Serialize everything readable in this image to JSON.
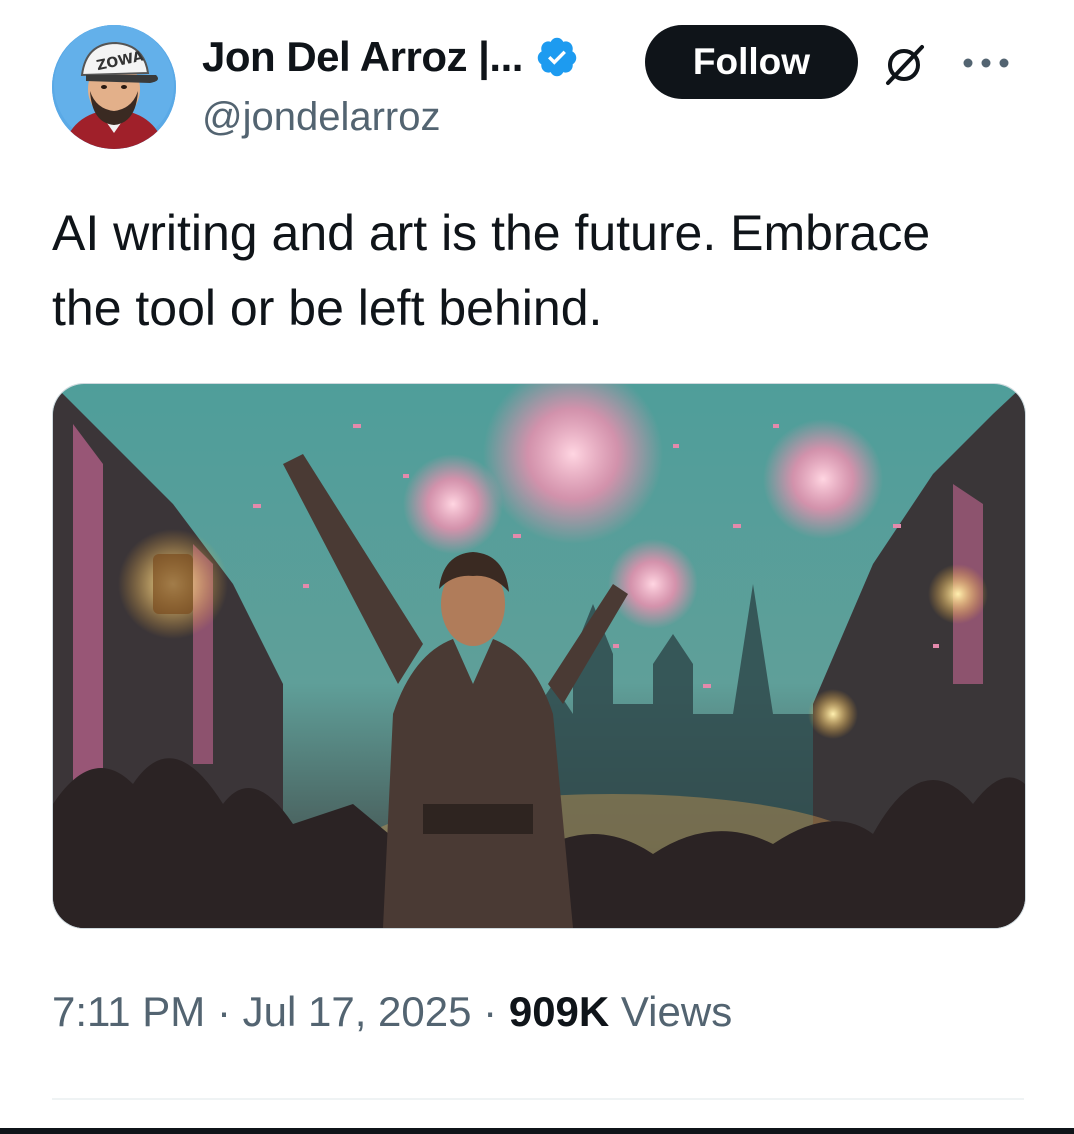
{
  "author": {
    "display_name": "Jon Del Arroz |...",
    "handle": "@jondelarroz",
    "verified": true,
    "avatar_cap_text": "ZOWA"
  },
  "actions": {
    "follow_label": "Follow",
    "grok_icon": "grok-icon",
    "more_icon": "more-horizontal-icon"
  },
  "tweet": {
    "line1": "AI writing and art is the future. Embrace",
    "line2": "the tool or be left behind."
  },
  "media": {
    "description_icon": "festival-illustration"
  },
  "meta": {
    "time": "7:11 PM",
    "separator": "·",
    "date": "Jul 17, 2025",
    "views_count": "909K",
    "views_label": "Views"
  },
  "colors": {
    "primary_text": "#0f1419",
    "secondary_text": "#536471",
    "verified_blue": "#1d9bf0",
    "follow_bg": "#0f1419",
    "divider": "#eff3f4"
  }
}
